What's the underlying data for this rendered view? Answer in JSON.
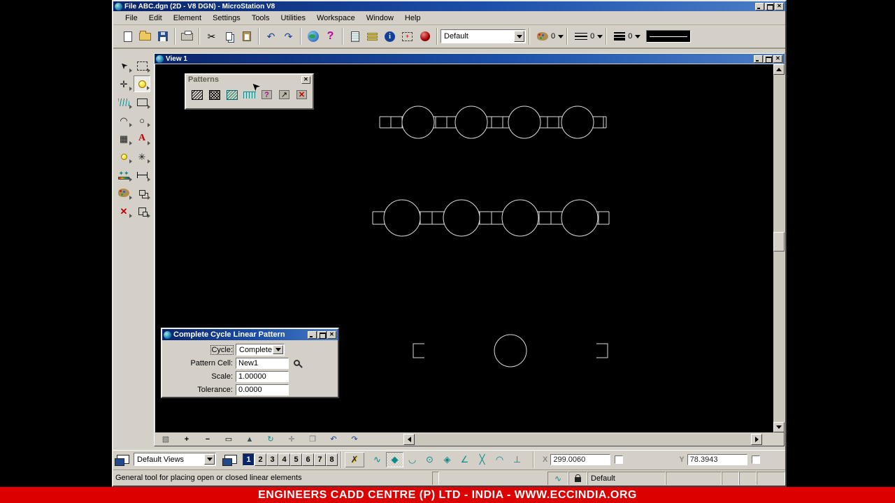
{
  "app": {
    "title": "File ABC.dgn (2D - V8 DGN) - MicroStation V8"
  },
  "chrome": {
    "close": "✕"
  },
  "menu": {
    "items": [
      "File",
      "Edit",
      "Element",
      "Settings",
      "Tools",
      "Utilities",
      "Workspace",
      "Window",
      "Help"
    ]
  },
  "toolbar": {
    "icons": {
      "cut": "✂",
      "undo": "↶",
      "redo": "↷",
      "help": "?",
      "info": "i",
      "fence_plus": "+"
    },
    "active_level": "Default",
    "color_value": "0",
    "style_value": "0",
    "weight_value": "0"
  },
  "palette": [
    {
      "name": "element-selection",
      "glyph": "➤"
    },
    {
      "name": "fence",
      "glyph": ""
    },
    {
      "name": "xy-points",
      "glyph": "✛"
    },
    {
      "name": "pattern-tool-active",
      "glyph": ""
    },
    {
      "name": "multiline",
      "glyph": ""
    },
    {
      "name": "polygons",
      "glyph": ""
    },
    {
      "name": "arcs",
      "glyph": "◠"
    },
    {
      "name": "ellipses",
      "glyph": "○"
    },
    {
      "name": "cells",
      "glyph": "▦"
    },
    {
      "name": "text",
      "glyph": "A"
    },
    {
      "name": "tags",
      "glyph": ""
    },
    {
      "name": "dimensions",
      "glyph": "✳"
    },
    {
      "name": "accudraw-points",
      "glyph": "✦✦"
    },
    {
      "name": "measure",
      "glyph": ""
    },
    {
      "name": "change-attributes",
      "glyph": ""
    },
    {
      "name": "groups",
      "glyph": ""
    },
    {
      "name": "delete-element",
      "glyph": "✕"
    },
    {
      "name": "drop-element",
      "glyph": ""
    }
  ],
  "view_window": {
    "title": "View 1"
  },
  "view_controls": [
    {
      "name": "view-attributes",
      "glyph": "▧"
    },
    {
      "name": "zoom-in",
      "glyph": "+"
    },
    {
      "name": "zoom-out",
      "glyph": "−"
    },
    {
      "name": "window-area",
      "glyph": "▭"
    },
    {
      "name": "fit-view",
      "glyph": "▲"
    },
    {
      "name": "rotate-view",
      "glyph": "↻"
    },
    {
      "name": "pan-view",
      "glyph": "✛"
    },
    {
      "name": "copy-view",
      "glyph": "❐"
    },
    {
      "name": "undo-view",
      "glyph": "↶"
    },
    {
      "name": "redo-view",
      "glyph": "↷"
    }
  ],
  "patterns_toolbox": {
    "title": "Patterns",
    "tools": [
      {
        "name": "hatch-area",
        "glyph": ""
      },
      {
        "name": "crosshatch-area",
        "glyph": ""
      },
      {
        "name": "pattern-area",
        "glyph": ""
      },
      {
        "name": "linear-pattern",
        "glyph": ""
      },
      {
        "name": "show-pattern-attributes",
        "glyph": "?"
      },
      {
        "name": "match-pattern-attributes",
        "glyph": "↗"
      },
      {
        "name": "delete-pattern",
        "glyph": "✕"
      }
    ]
  },
  "dialog": {
    "title": "Complete Cycle Linear Pattern",
    "cycle_label": "Cycle:",
    "cycle_value": "Complete",
    "pattern_cell_label": "Pattern Cell:",
    "pattern_cell_value": "New1",
    "scale_label": "Scale:",
    "scale_value": "1.00000",
    "tolerance_label": "Tolerance:",
    "tolerance_value": "0.0000"
  },
  "bottom_toolbar": {
    "views_combo": "Default Views",
    "view_numbers": [
      "1",
      "2",
      "3",
      "4",
      "5",
      "6",
      "7",
      "8"
    ],
    "active_view": "1",
    "snaps": [
      {
        "name": "toggle-accusnap",
        "glyph": "✗"
      },
      {
        "name": "nearest-snap",
        "glyph": "∿"
      },
      {
        "name": "keypoint-snap",
        "glyph": "◆"
      },
      {
        "name": "midpoint-snap",
        "glyph": "◡"
      },
      {
        "name": "center-snap",
        "glyph": "⊙"
      },
      {
        "name": "origin-snap",
        "glyph": "◈"
      },
      {
        "name": "bisector-snap",
        "glyph": "∠"
      },
      {
        "name": "intersection-snap",
        "glyph": "╳"
      },
      {
        "name": "tangent-snap",
        "glyph": "◠"
      },
      {
        "name": "perpendicular-snap",
        "glyph": "⊥"
      }
    ],
    "x_label": "X",
    "x_value": "299.0060",
    "y_label": "Y",
    "y_value": "78.3943"
  },
  "status_bar": {
    "message": "General tool for placing open or closed linear elements",
    "active_level": "Default"
  },
  "banner": {
    "text": "ENGINEERS CADD CENTRE (P) LTD - INDIA - WWW.ECCINDIA.ORG",
    "bg": "#dc0000"
  },
  "drawing_colors": {
    "line": "#dcdcdc",
    "canvas": "#000000"
  }
}
